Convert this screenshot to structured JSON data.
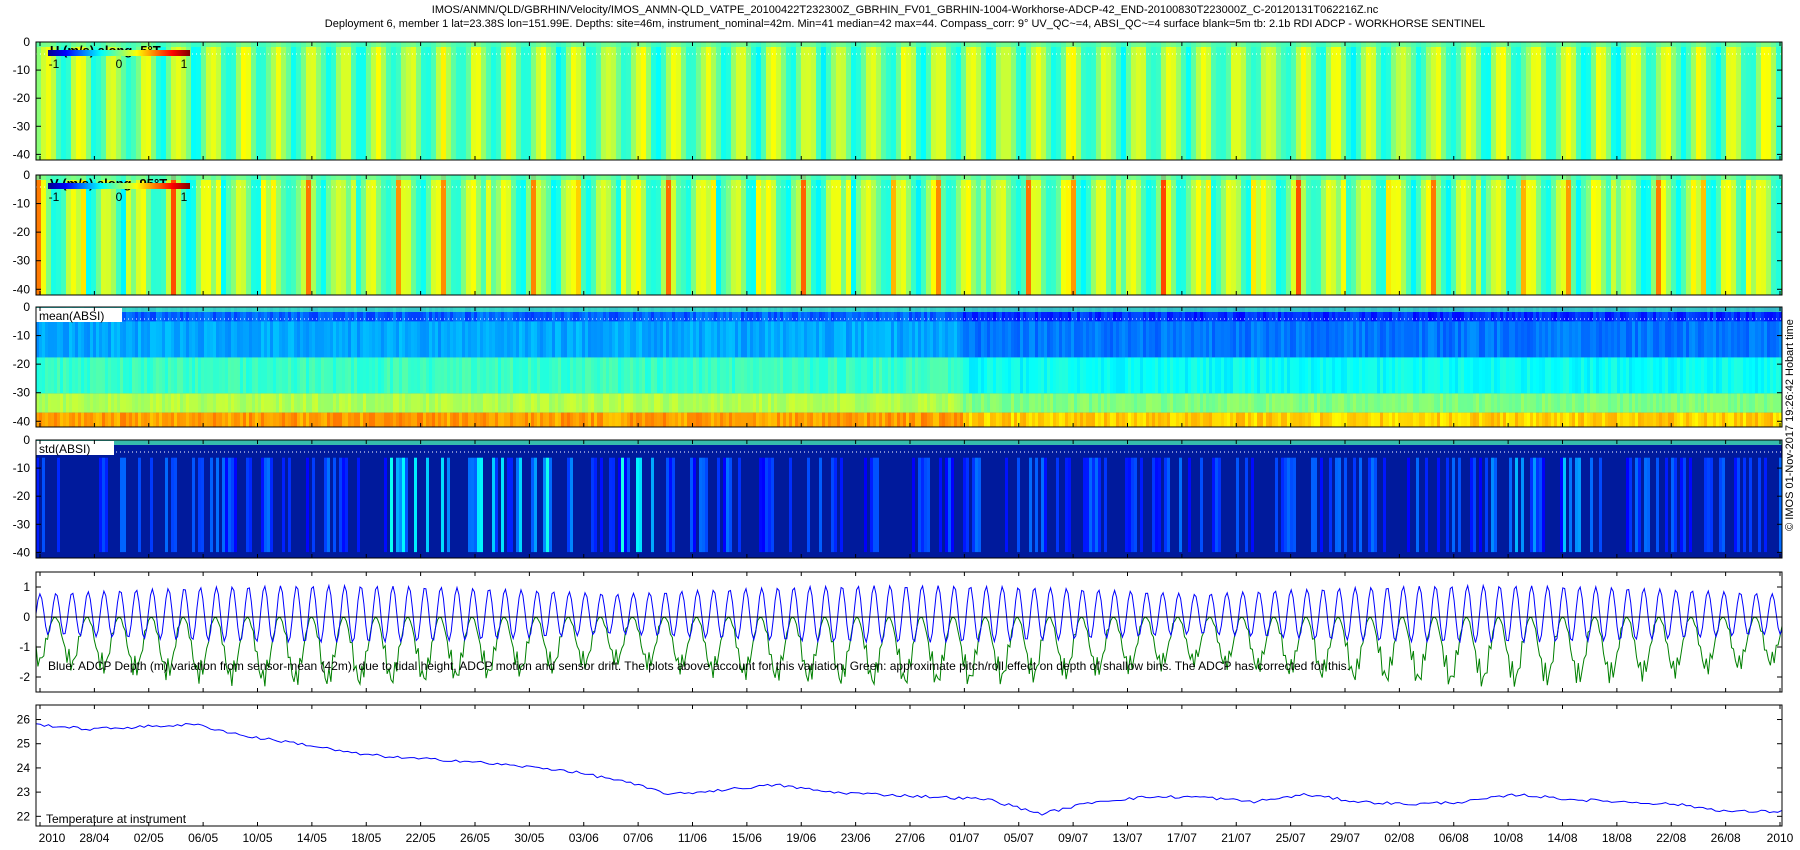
{
  "chart_data": {
    "title_line1": "IMOS/ANMN/QLD/GBRHIN/Velocity/IMOS_ANMN-QLD_VATPE_20100422T232300Z_GBRHIN_FV01_GBRHIN-1004-Workhorse-ADCP-42_END-20100830T223000Z_C-20120131T062216Z.nc",
    "title_line2": "Deployment 6, member 1 lat=23.38S lon=151.99E. Depths: site=46m, instrument_nominal=42m. Min=41 median=42 max=44. Compass_corr: 9° UV_QC~=4, ABSI_QC~=4 surface blank=5m tb: 2.1b RDI ADCP - WORKHORSE SENTINEL",
    "side_label": "© IMOS 01-Nov-2017 19:26:42 Hobart time",
    "x_tick_labels": [
      "2010",
      "28/04",
      "02/05",
      "06/05",
      "10/05",
      "14/05",
      "18/05",
      "22/05",
      "26/05",
      "30/05",
      "03/06",
      "07/06",
      "11/06",
      "15/06",
      "19/06",
      "23/06",
      "27/06",
      "01/07",
      "05/07",
      "09/07",
      "13/07",
      "17/07",
      "21/07",
      "25/07",
      "29/07",
      "02/08",
      "06/08",
      "10/08",
      "14/08",
      "18/08",
      "22/08",
      "26/08",
      "2010"
    ],
    "panels": [
      {
        "type": "heatmap",
        "label": "U (m/s) along -5°T",
        "y_ticks": [
          "0",
          "-10",
          "-20",
          "-30",
          "-40"
        ],
        "ylim": [
          -42,
          0
        ],
        "colorbar_ticks": [
          "-1",
          "0",
          "1"
        ],
        "clim": [
          -1.5,
          1.5
        ],
        "colormap": "jet"
      },
      {
        "type": "heatmap",
        "label": "V (m/s) along -95°T",
        "y_ticks": [
          "0",
          "-10",
          "-20",
          "-30",
          "-40"
        ],
        "ylim": [
          -42,
          0
        ],
        "colorbar_ticks": [
          "-1",
          "0",
          "1"
        ],
        "clim": [
          -1.5,
          1.5
        ],
        "colormap": "jet"
      },
      {
        "type": "heatmap",
        "label": "mean(ABSI)",
        "y_ticks": [
          "0",
          "-10",
          "-20",
          "-30",
          "-40"
        ],
        "ylim": [
          -42,
          0
        ],
        "colormap": "jet"
      },
      {
        "type": "heatmap",
        "label": "std(ABSI)",
        "y_ticks": [
          "0",
          "-10",
          "-20",
          "-30",
          "-40"
        ],
        "ylim": [
          -42,
          0
        ],
        "colormap": "jet"
      },
      {
        "type": "line",
        "label": "Blue: ADCP Depth (m) variation from sensor-mean (42m), due to tidal height, ADCP motion and sensor drift. The plots above account for this variation. Green: approximate pitch/roll effect on depth of shallow bins. The ADCP has corrected for this.",
        "y_ticks": [
          "1",
          "0",
          "-1",
          "-2"
        ],
        "ylim": [
          -2.5,
          1.5
        ],
        "series": [
          {
            "color": "#0000ff",
            "amplitude_m": 1.0
          },
          {
            "color": "#008000",
            "min_m": -2.5
          }
        ]
      },
      {
        "type": "line",
        "label": "Temperature at instrument",
        "y_ticks": [
          "26",
          "25",
          "24",
          "23",
          "22"
        ],
        "ylim": [
          21.6,
          26.6
        ],
        "series": [
          {
            "color": "#0000ff",
            "x_dates": [
              "22/04",
              "28/04",
              "02/05",
              "06/05",
              "10/05",
              "14/05",
              "18/05",
              "22/05",
              "26/05",
              "30/05",
              "03/06",
              "07/06",
              "11/06",
              "15/06",
              "19/06",
              "23/06",
              "27/06",
              "01/07",
              "04/07",
              "05/07",
              "09/07",
              "13/07",
              "17/07",
              "21/07",
              "25/07",
              "29/07",
              "02/08",
              "06/08",
              "10/08",
              "14/08",
              "18/08",
              "22/08",
              "26/08",
              "30/08"
            ],
            "values": [
              25.8,
              25.6,
              25.7,
              25.8,
              25.3,
              25.0,
              24.6,
              24.4,
              24.3,
              24.1,
              23.9,
              23.5,
              22.9,
              23.1,
              23.3,
              23.0,
              22.9,
              22.8,
              22.7,
              22.1,
              22.6,
              22.8,
              22.8,
              22.6,
              22.9,
              22.6,
              22.5,
              22.6,
              22.9,
              22.7,
              22.6,
              22.5,
              22.2,
              22.2
            ]
          }
        ]
      }
    ]
  }
}
